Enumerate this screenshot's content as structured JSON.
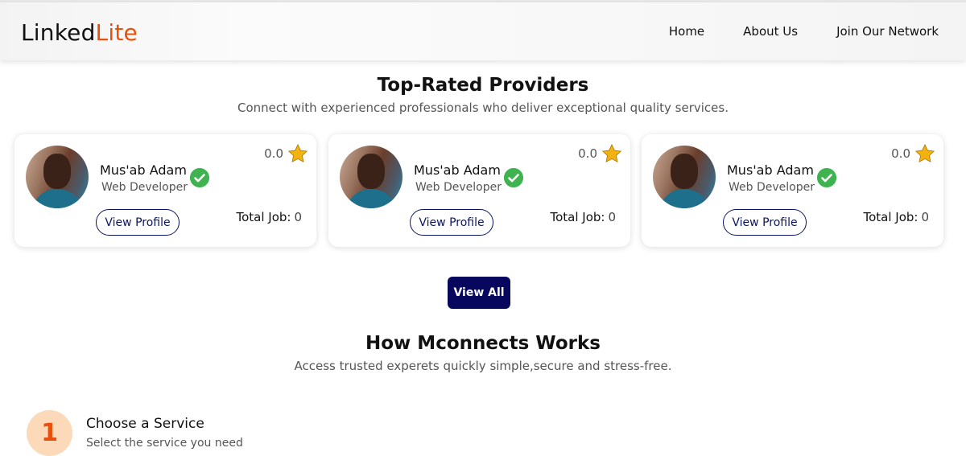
{
  "navbar": {
    "brand_primary": "Linked",
    "brand_accent": "Lite",
    "links": [
      {
        "label": "Home"
      },
      {
        "label": "About Us"
      },
      {
        "label": "Join Our Network"
      }
    ]
  },
  "providers_section": {
    "title": "Top-Rated Providers",
    "subtitle": "Connect with experienced professionals who deliver exceptional quality services."
  },
  "providers": [
    {
      "name": "Mus'ab Adam",
      "role": "Web Developer",
      "rating": "0.0",
      "view_label": "View Profile",
      "jobs_label": "Total Job:",
      "jobs_count": "0"
    },
    {
      "name": "Mus'ab Adam",
      "role": "Web Developer",
      "rating": "0.0",
      "view_label": "View Profile",
      "jobs_label": "Total Job:",
      "jobs_count": "0"
    },
    {
      "name": "Mus'ab Adam",
      "role": "Web Developer",
      "rating": "0.0",
      "view_label": "View Profile",
      "jobs_label": "Total Job:",
      "jobs_count": "0"
    }
  ],
  "view_all_label": "View All",
  "how_section": {
    "title": "How Mconnects Works",
    "subtitle": "Access trusted experets quickly simple,secure and stress-free."
  },
  "steps": [
    {
      "number": "1",
      "title": "Choose a Service",
      "description": "Select the service you need"
    }
  ],
  "colors": {
    "brand_accent": "#e8510c",
    "primary_button": "#07075e",
    "verified": "#3fb34f",
    "star": "#f2b311",
    "step_badge_bg": "#fcd9b8"
  },
  "icons": {
    "rating": "star-icon",
    "verified": "verified-check-icon"
  }
}
